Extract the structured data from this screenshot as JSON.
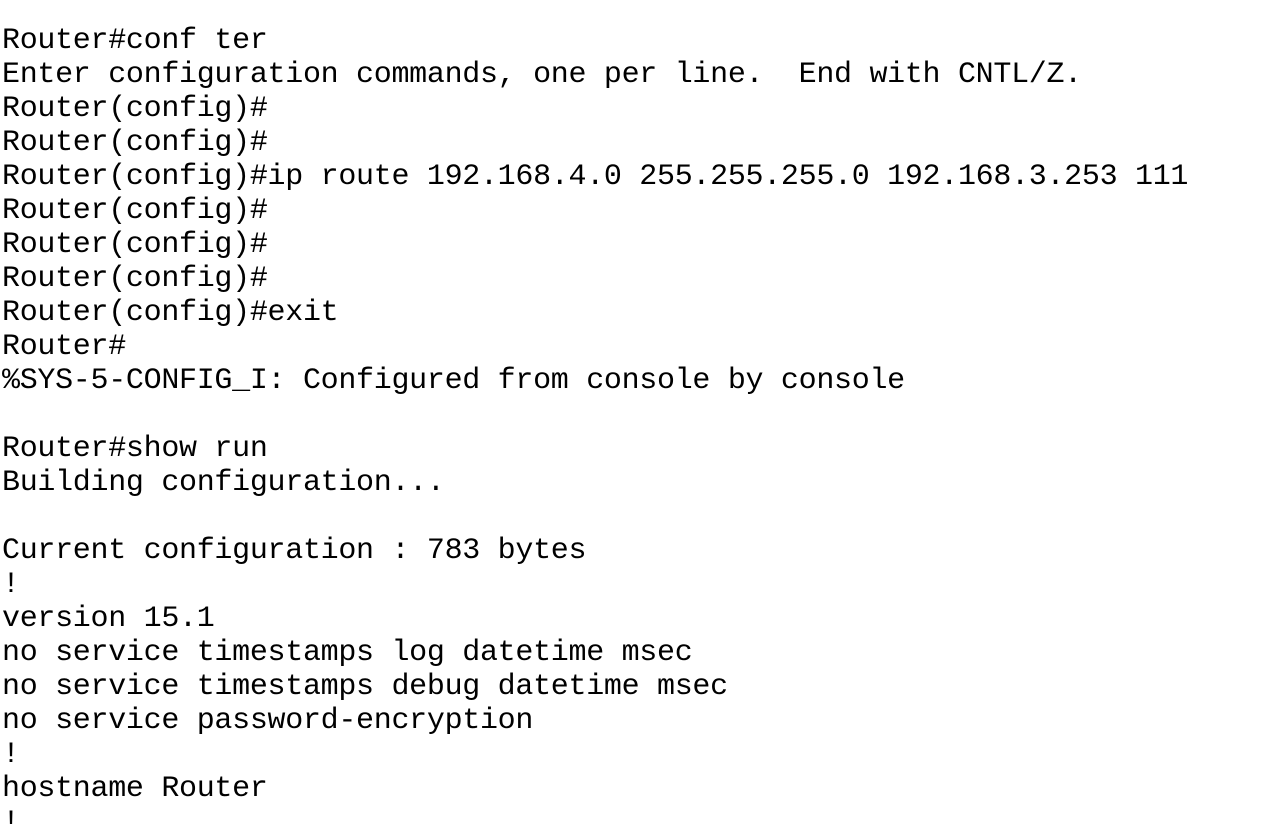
{
  "terminal": {
    "lines": [
      "Router#conf ter",
      "Enter configuration commands, one per line.  End with CNTL/Z.",
      "Router(config)#",
      "Router(config)#",
      "Router(config)#ip route 192.168.4.0 255.255.255.0 192.168.3.253 111",
      "Router(config)#",
      "Router(config)#",
      "Router(config)#",
      "Router(config)#exit",
      "Router#",
      "%SYS-5-CONFIG_I: Configured from console by console",
      "",
      "Router#show run",
      "Building configuration...",
      "",
      "Current configuration : 783 bytes",
      "!",
      "version 15.1",
      "no service timestamps log datetime msec",
      "no service timestamps debug datetime msec",
      "no service password-encryption",
      "!",
      "hostname Router",
      "!"
    ]
  }
}
